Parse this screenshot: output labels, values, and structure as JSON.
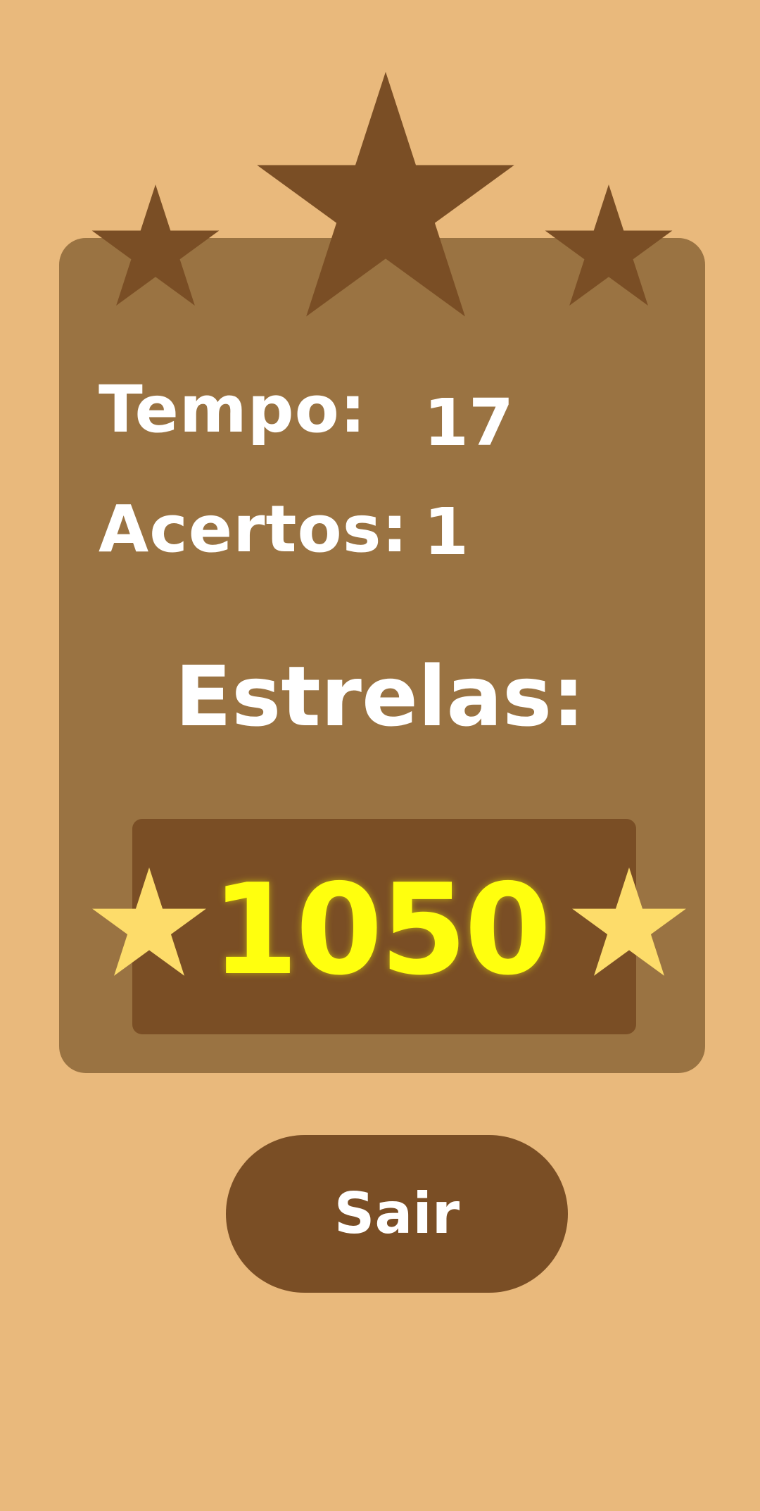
{
  "results": {
    "time_label": "Tempo:",
    "time_value": "17",
    "hits_label": "Acertos:",
    "hits_value": "1",
    "stars_label": "Estrelas:",
    "score_value": "1050",
    "stars_earned": 0,
    "stars_total": 3
  },
  "actions": {
    "exit_label": "Sair"
  },
  "icons": {
    "rating_stars": [
      "star-icon",
      "star-icon",
      "star-icon"
    ],
    "score_stars": [
      "star-icon",
      "star-icon"
    ]
  },
  "colors": {
    "background": "#e9b97c",
    "panel": "#9a7342",
    "dark_brown": "#7a4e25",
    "score_text": "#ffff0e",
    "gold_star": "#fddc6a",
    "text": "#ffffff"
  }
}
